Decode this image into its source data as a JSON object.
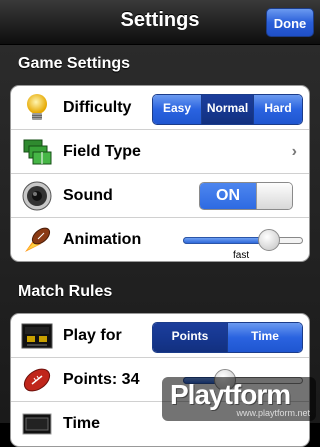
{
  "navbar": {
    "title": "Settings",
    "done_label": "Done"
  },
  "game_settings": {
    "header": "Game Settings",
    "difficulty": {
      "label": "Difficulty",
      "icon": "lightbulb-icon",
      "options": [
        "Easy",
        "Normal",
        "Hard"
      ],
      "selected": "Normal"
    },
    "field_type": {
      "label": "Field Type",
      "icon": "field-icon",
      "chevron": "›"
    },
    "sound": {
      "label": "Sound",
      "icon": "speaker-icon",
      "toggle_label": "ON",
      "on": true
    },
    "animation": {
      "label": "Animation",
      "icon": "football-fire-icon",
      "slider_value": 0.72,
      "caption": "fast"
    }
  },
  "match_rules": {
    "header": "Match Rules",
    "play_for": {
      "label": "Play for",
      "icon": "scoreboard-icon",
      "options": [
        "Points",
        "Time"
      ],
      "selected": "Points"
    },
    "points": {
      "label": "Points: 34",
      "icon": "football-icon",
      "slider_value": 0.35
    },
    "time": {
      "label": "Time",
      "icon": "clock-display-icon"
    }
  },
  "watermark": {
    "brand": "Playtform",
    "url": "www.playtform.net"
  },
  "colors": {
    "accent": "#2a63e0",
    "selected_segment": "#163790",
    "background": "#232323"
  }
}
